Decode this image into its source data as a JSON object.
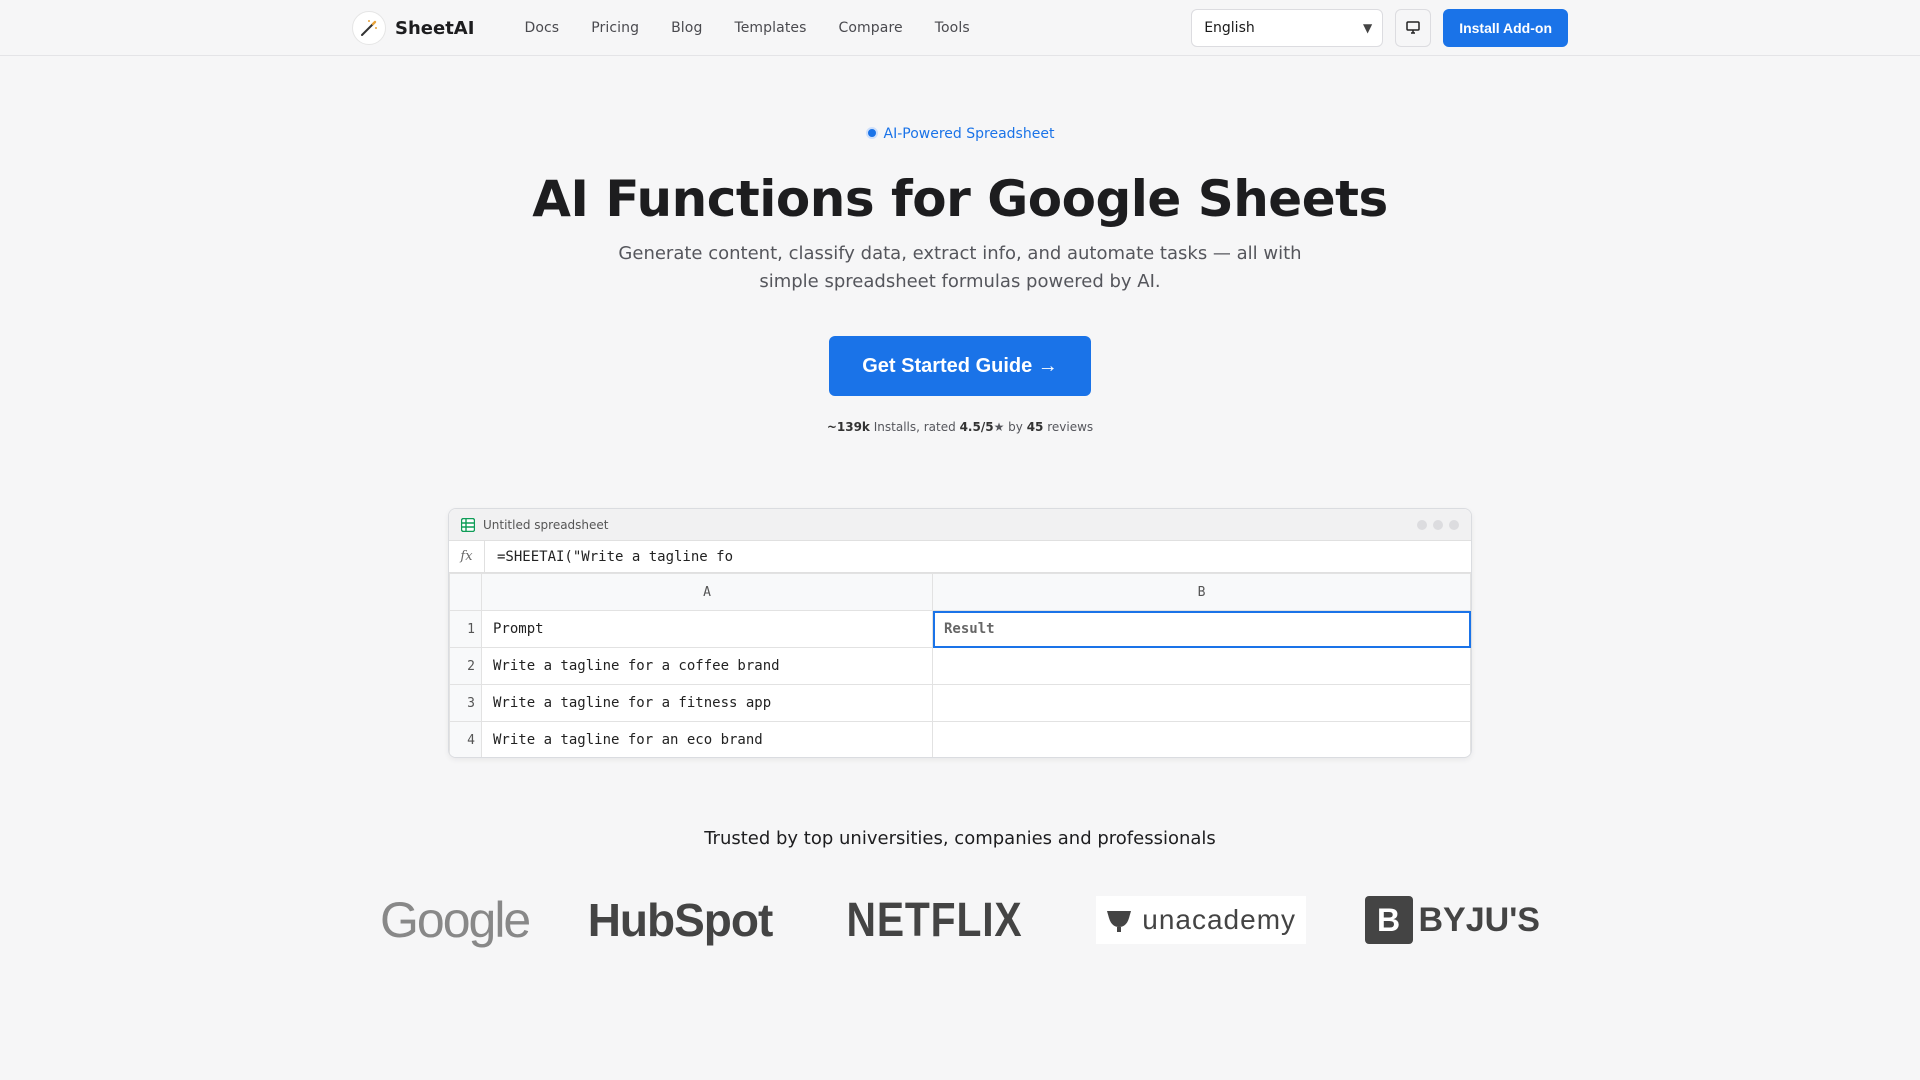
{
  "nav": {
    "brand": "SheetAI",
    "links": [
      "Docs",
      "Pricing",
      "Blog",
      "Templates",
      "Compare",
      "Tools"
    ],
    "language": "English",
    "install_label": "Install Add-on"
  },
  "hero": {
    "badge": "AI-Powered Spreadsheet",
    "title": "AI Functions for Google Sheets",
    "subtitle": "Generate content, classify data, extract info, and automate tasks — all with simple spreadsheet formulas powered by AI.",
    "cta": "Get Started Guide →",
    "stats": {
      "installs": "~139k",
      "installs_label": "Installs, rated",
      "rating": "4.5/5",
      "star": "★",
      "by": "by",
      "reviews_count": "45",
      "reviews_label": "reviews"
    }
  },
  "spreadsheet": {
    "title": "Untitled spreadsheet",
    "fx": "fx",
    "formula": "=SHEETAI(\"Write a tagline fo",
    "columns": [
      "A",
      "B"
    ],
    "rows": [
      {
        "num": "1",
        "a": "Prompt",
        "b": "Result"
      },
      {
        "num": "2",
        "a": "Write a tagline for a coffee brand",
        "b": ""
      },
      {
        "num": "3",
        "a": "Write a tagline for a fitness app",
        "b": ""
      },
      {
        "num": "4",
        "a": "Write a tagline for an eco brand",
        "b": ""
      }
    ]
  },
  "trusted": {
    "heading": "Trusted by top universities, companies and professionals",
    "logos": [
      "Google",
      "HubSpot",
      "NETFLIX",
      "unacademy",
      "BYJU'S"
    ]
  },
  "colors": {
    "accent": "#1a73e8",
    "background": "#f6f6f7"
  }
}
